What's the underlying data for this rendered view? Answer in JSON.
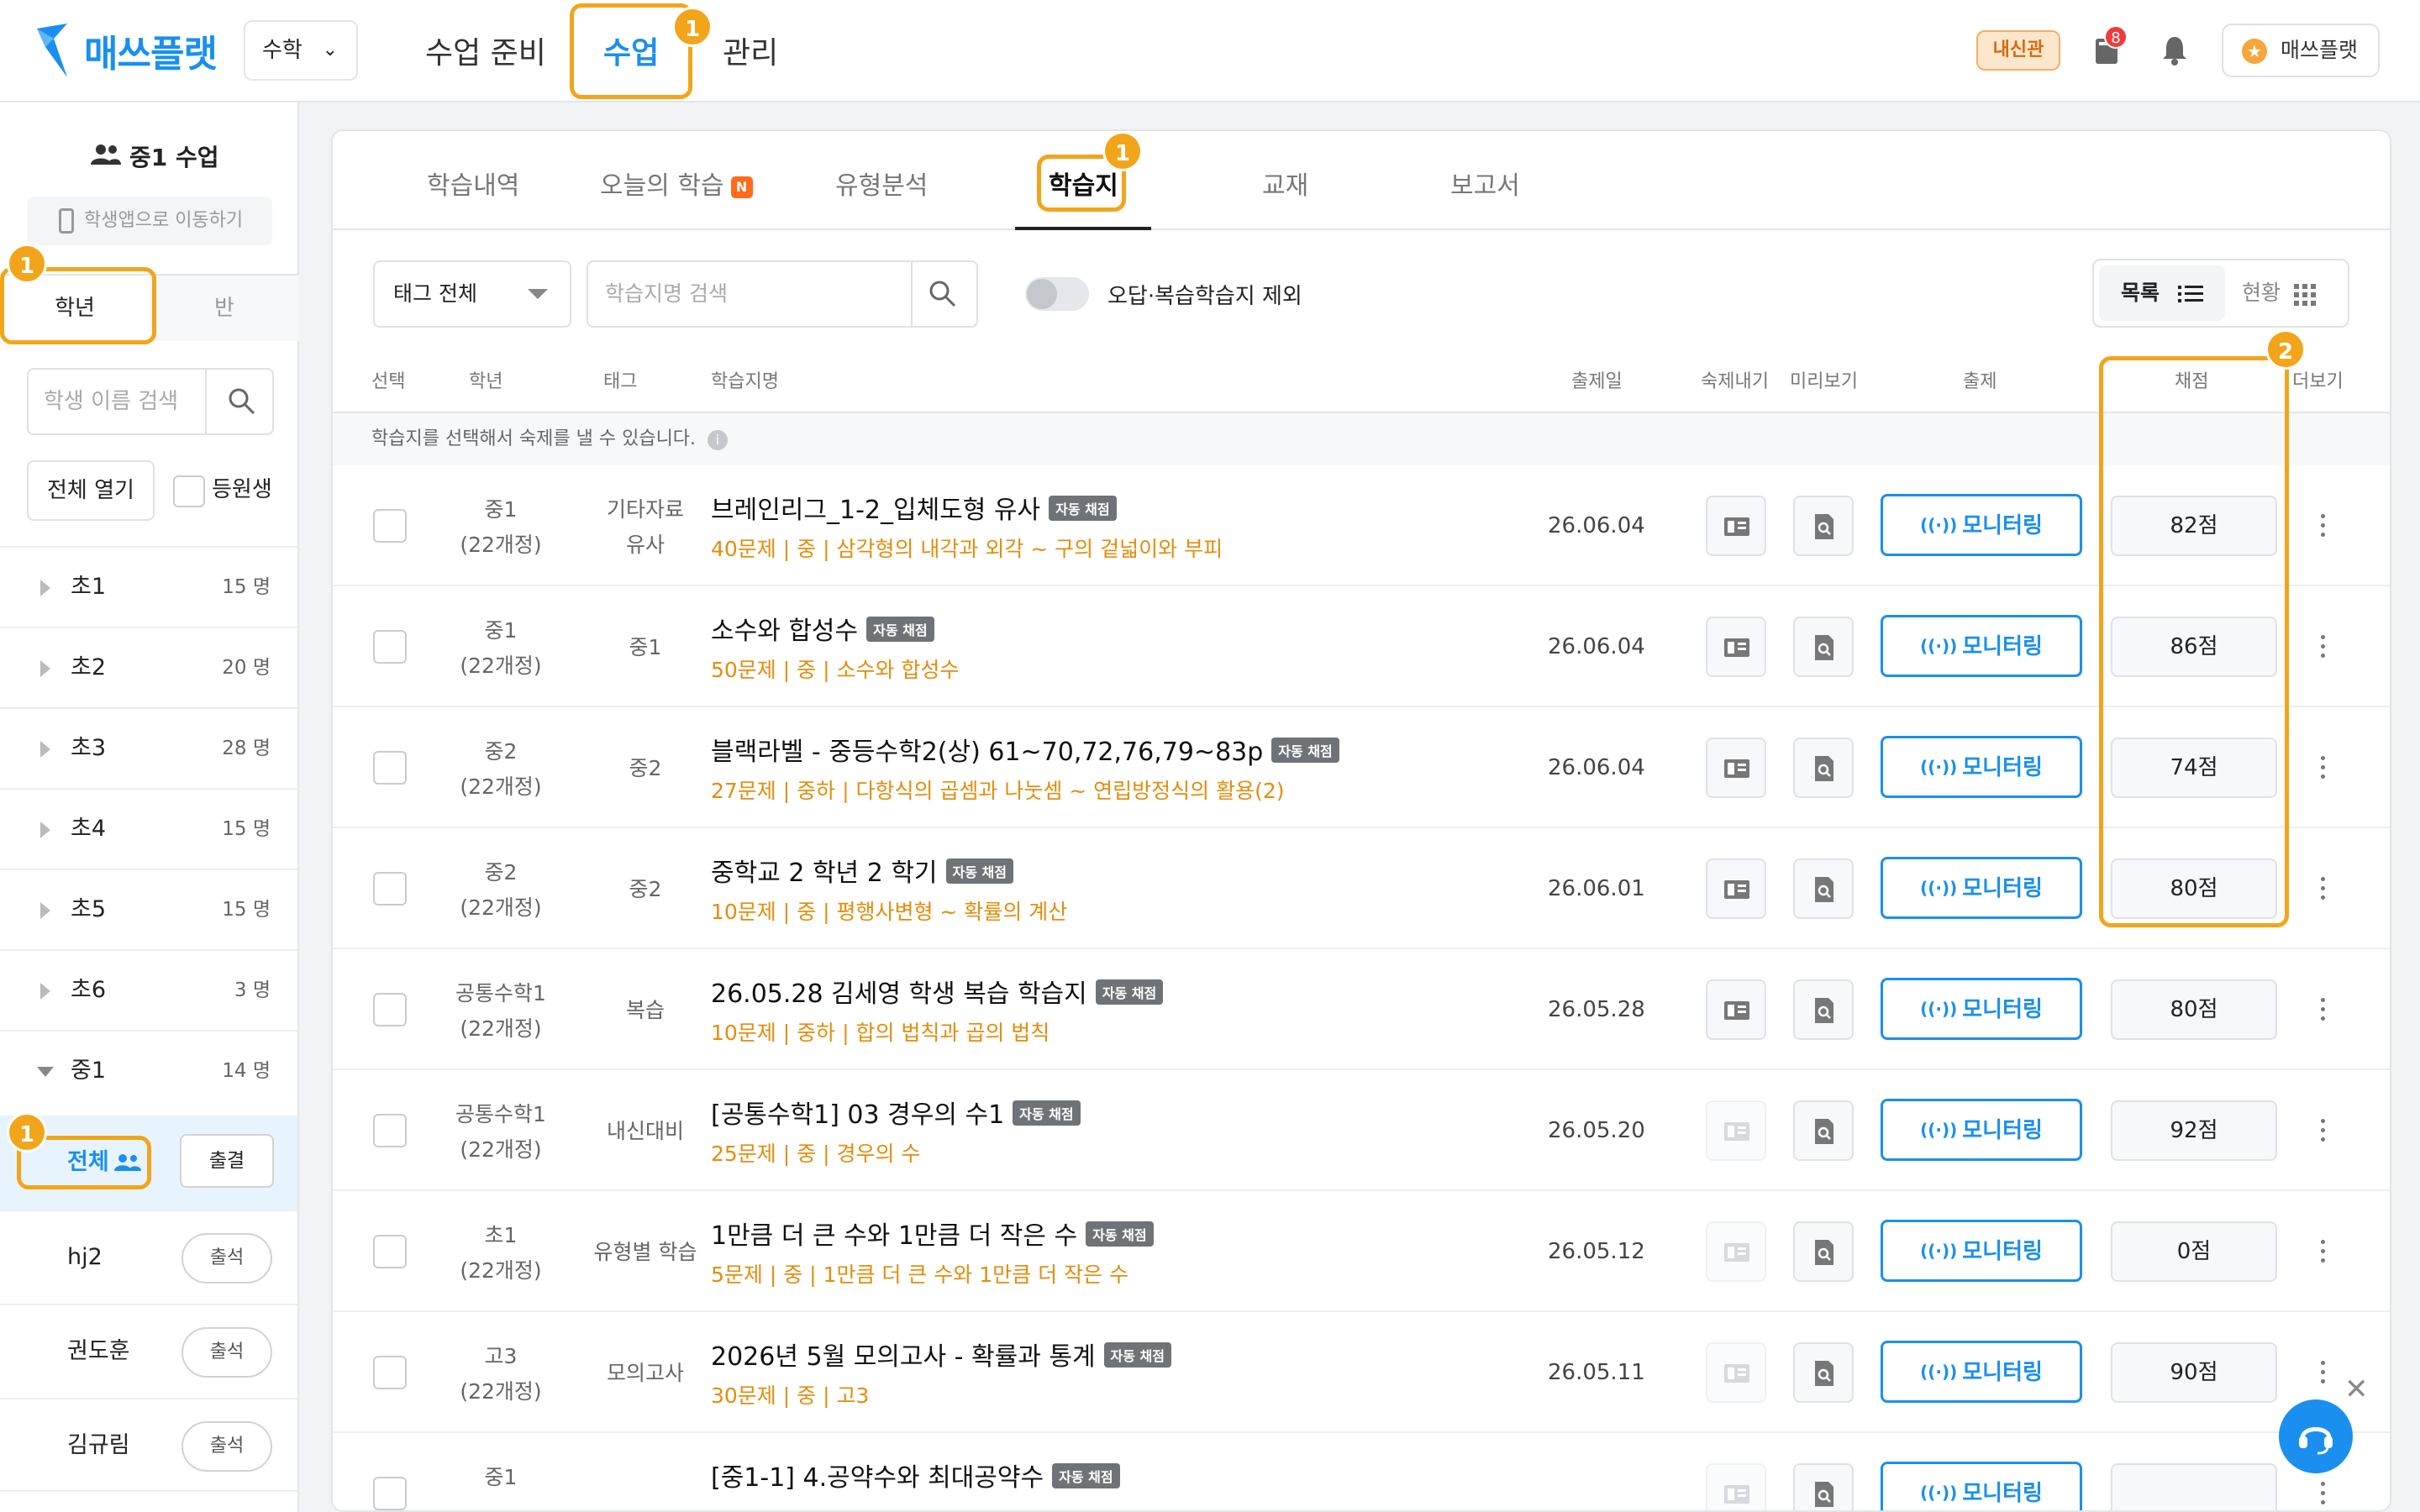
{
  "header": {
    "logo_text": "매쓰플랫",
    "subject": "수학",
    "nav": [
      "수업 준비",
      "수업",
      "관리"
    ],
    "exam_badge": "내신관",
    "notif_count": "8",
    "user_name": "매쓰플랫",
    "highlight_badge": "1"
  },
  "sidebar": {
    "class_title": "중1 수업",
    "app_link": "학생앱으로 이동하기",
    "tabs": [
      "학년",
      "반"
    ],
    "search_placeholder": "학생 이름 검색",
    "open_all": "전체 열기",
    "enrolled_label": "등원생",
    "grades": [
      {
        "name": "초1",
        "count": "15 명"
      },
      {
        "name": "초2",
        "count": "20 명"
      },
      {
        "name": "초3",
        "count": "28 명"
      },
      {
        "name": "초4",
        "count": "15 명"
      },
      {
        "name": "초5",
        "count": "15 명"
      },
      {
        "name": "초6",
        "count": "3 명"
      },
      {
        "name": "중1",
        "count": "14 명"
      }
    ],
    "all_label": "전체",
    "all_attendance": "출결",
    "students": [
      {
        "name": "hj2",
        "attend": "출석"
      },
      {
        "name": "권도훈",
        "attend": "출석"
      },
      {
        "name": "김규림",
        "attend": "출석"
      }
    ]
  },
  "main": {
    "tabs": [
      "학습내역",
      "오늘의 학습",
      "유형분석",
      "학습지",
      "교재",
      "보고서"
    ],
    "new_badge": "N",
    "tag_filter": "태그 전체",
    "search_placeholder": "학습지명 검색",
    "toggle_label": "오답·복습학습지 제외",
    "view_list": "목록",
    "view_grid": "현황",
    "columns": {
      "select": "선택",
      "grade": "학년",
      "tag": "태그",
      "name": "학습지명",
      "date": "출제일",
      "homework": "숙제내기",
      "preview": "미리보기",
      "assign": "출제",
      "score": "채점",
      "more": "더보기"
    },
    "hint": "학습지를 선택해서 숙제를 낼 수 있습니다.",
    "auto_label": "자동 채점",
    "monitor_label": "모니터링",
    "badge2": "2",
    "rows": [
      {
        "grade1": "중1",
        "grade2": "(22개정)",
        "tag1": "기타자료",
        "tag2": "유사",
        "title": "브레인리그_1-2_입체도형 유사",
        "desc": "40문제 | 중 | 삼각형의 내각과 외각 ~ 구의 겉넓이와 부피",
        "date": "26.06.04",
        "score": "82점",
        "hw_active": true
      },
      {
        "grade1": "중1",
        "grade2": "(22개정)",
        "tag1": "중1",
        "tag2": "",
        "title": "소수와 합성수",
        "desc": "50문제 | 중 | 소수와 합성수",
        "date": "26.06.04",
        "score": "86점",
        "hw_active": true
      },
      {
        "grade1": "중2",
        "grade2": "(22개정)",
        "tag1": "중2",
        "tag2": "",
        "title": "블랙라벨 - 중등수학2(상) 61~70,72,76,79~83p",
        "desc": "27문제 | 중하 | 다항식의 곱셈과 나눗셈 ~ 연립방정식의 활용(2)",
        "date": "26.06.04",
        "score": "74점",
        "hw_active": true
      },
      {
        "grade1": "중2",
        "grade2": "(22개정)",
        "tag1": "중2",
        "tag2": "",
        "title": "중학교 2 학년 2 학기",
        "desc": "10문제 | 중 | 평행사변형 ~ 확률의 계산",
        "date": "26.06.01",
        "score": "80점",
        "hw_active": true
      },
      {
        "grade1": "공통수학1",
        "grade2": "(22개정)",
        "tag1": "복습",
        "tag2": "",
        "title": "26.05.28 김세영 학생 복습 학습지",
        "desc": "10문제 | 중하 | 합의 법칙과 곱의 법칙",
        "date": "26.05.28",
        "score": "80점",
        "hw_active": true
      },
      {
        "grade1": "공통수학1",
        "grade2": "(22개정)",
        "tag1": "내신대비",
        "tag2": "",
        "title": "[공통수학1] 03 경우의 수1",
        "desc": "25문제 | 중 | 경우의 수",
        "date": "26.05.20",
        "score": "92점",
        "hw_active": false
      },
      {
        "grade1": "초1",
        "grade2": "(22개정)",
        "tag1": "유형별 학습",
        "tag2": "",
        "title": "1만큼 더 큰 수와 1만큼 더 작은 수",
        "desc": "5문제 | 중 | 1만큼 더 큰 수와 1만큼 더 작은 수",
        "date": "26.05.12",
        "score": "0점",
        "hw_active": false
      },
      {
        "grade1": "고3",
        "grade2": "(22개정)",
        "tag1": "모의고사",
        "tag2": "",
        "title": "2026년 5월 모의고사 - 확률과 통계",
        "desc": "30문제 | 중 | 고3",
        "date": "26.05.11",
        "score": "90점",
        "hw_active": false
      },
      {
        "grade1": "중1",
        "grade2": "",
        "tag1": "",
        "tag2": "",
        "title": "[중1-1] 4.공약수와 최대공약수",
        "desc": "",
        "date": "",
        "score": "",
        "hw_active": false
      }
    ]
  },
  "colors": {
    "brand": "#1a8ff0",
    "highlight": "#f2a51b",
    "desc": "#e38d0d"
  }
}
